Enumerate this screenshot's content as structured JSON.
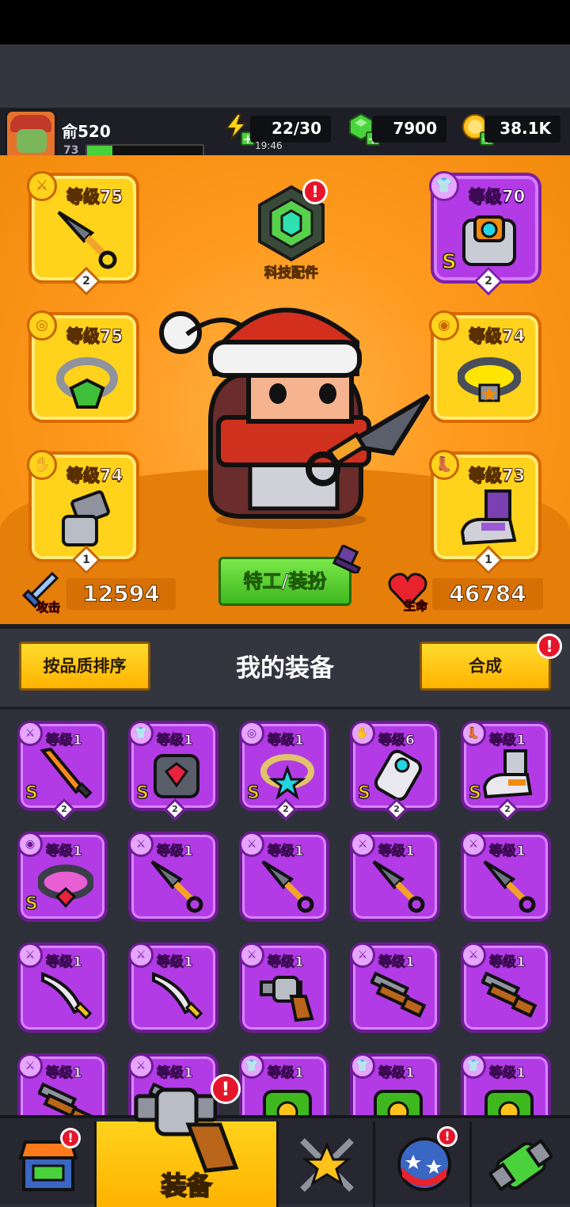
{
  "player": {
    "name": "俞520",
    "level": "73",
    "xp_fraction": 0.22
  },
  "resources": {
    "energy": "22/30",
    "energy_timer": "19:46",
    "gems": "7900",
    "coins": "38.1K"
  },
  "equipped": {
    "weapon": {
      "level": "等级75",
      "stars": "2"
    },
    "armor": {
      "level": "等级70",
      "grade": "S",
      "stars": "2"
    },
    "ring": {
      "level": "等级75"
    },
    "necklace": {
      "level": "等级74"
    },
    "gloves": {
      "level": "等级74",
      "stars": "1"
    },
    "boots": {
      "level": "等级73",
      "stars": "1"
    }
  },
  "tech": {
    "label": "科技配件",
    "alert": "!"
  },
  "stats": {
    "attack_label": "攻击",
    "attack_value": "12594",
    "hp_label": "生命",
    "hp_value": "46784"
  },
  "costume_button": "特工/装扮",
  "equipment": {
    "title": "我的装备",
    "sort_button": "按品质排序",
    "merge_button": "合成",
    "merge_alert": "!",
    "items": [
      {
        "type": "weapon",
        "level": "等级1",
        "grade": "S",
        "stars": "2",
        "art": "flame-sword"
      },
      {
        "type": "armor",
        "level": "等级1",
        "grade": "S",
        "stars": "2",
        "art": "dark-armor"
      },
      {
        "type": "ring",
        "level": "等级1",
        "grade": "S",
        "stars": "2",
        "art": "star-ring"
      },
      {
        "type": "gloves",
        "level": "等级6",
        "grade": "S",
        "stars": "2",
        "art": "tech-glove"
      },
      {
        "type": "boots",
        "level": "等级1",
        "grade": "S",
        "stars": "2",
        "art": "tech-boots"
      },
      {
        "type": "necklace",
        "level": "等级1",
        "grade": "S",
        "stars": "",
        "art": "dark-collar"
      },
      {
        "type": "weapon",
        "level": "等级1",
        "grade": "",
        "stars": "",
        "art": "kunai"
      },
      {
        "type": "weapon",
        "level": "等级1",
        "grade": "",
        "stars": "",
        "art": "kunai"
      },
      {
        "type": "weapon",
        "level": "等级1",
        "grade": "",
        "stars": "",
        "art": "kunai"
      },
      {
        "type": "weapon",
        "level": "等级1",
        "grade": "",
        "stars": "",
        "art": "kunai"
      },
      {
        "type": "weapon",
        "level": "等级1",
        "grade": "",
        "stars": "",
        "art": "machete"
      },
      {
        "type": "weapon",
        "level": "等级1",
        "grade": "",
        "stars": "",
        "art": "machete"
      },
      {
        "type": "weapon",
        "level": "等级1",
        "grade": "",
        "stars": "",
        "art": "revolver"
      },
      {
        "type": "weapon",
        "level": "等级1",
        "grade": "",
        "stars": "",
        "art": "shotgun"
      },
      {
        "type": "weapon",
        "level": "等级1",
        "grade": "",
        "stars": "",
        "art": "shotgun"
      },
      {
        "type": "weapon",
        "level": "等级1",
        "grade": "",
        "stars": "",
        "art": "shotgun"
      },
      {
        "type": "weapon",
        "level": "等级1",
        "grade": "",
        "stars": "",
        "art": "shotgun"
      },
      {
        "type": "armor",
        "level": "等级1",
        "grade": "",
        "stars": "",
        "art": "green-armor"
      },
      {
        "type": "armor",
        "level": "等级1",
        "grade": "",
        "stars": "",
        "art": "green-armor"
      },
      {
        "type": "armor",
        "level": "等级1",
        "grade": "",
        "stars": "",
        "art": "green-armor"
      }
    ]
  },
  "nav": {
    "shop_alert": "!",
    "equipment_label": "装备",
    "equipment_alert": "!",
    "globe_alert": "!"
  },
  "colors": {
    "accent": "#ff9a1f",
    "purple": "#b23be6",
    "gold": "#ffd21c",
    "alert": "#e5162b"
  }
}
